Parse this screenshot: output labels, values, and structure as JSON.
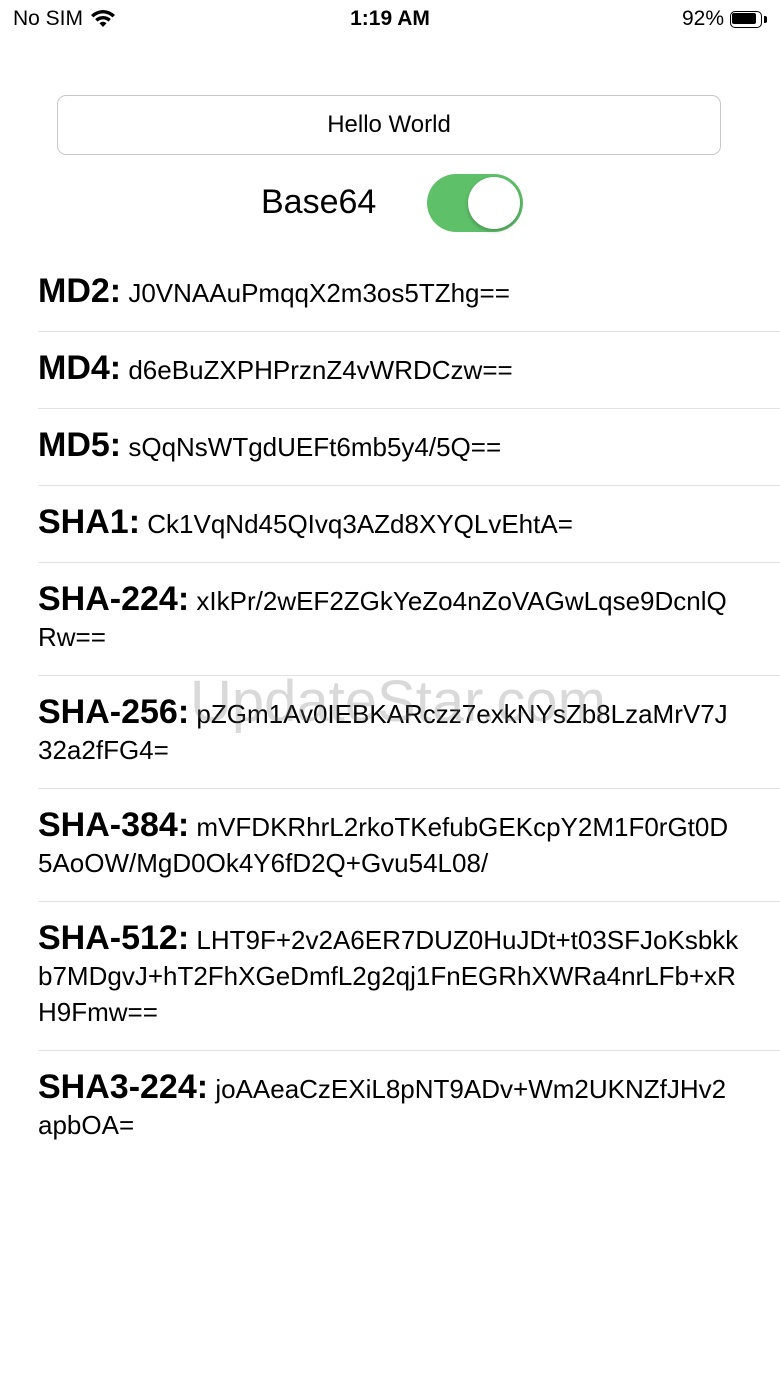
{
  "status_bar": {
    "carrier": "No SIM",
    "time": "1:19 AM",
    "battery_percent": "92%",
    "battery_level": 0.92,
    "icons": [
      "wifi-icon",
      "battery-icon"
    ]
  },
  "input": {
    "value": "Hello World"
  },
  "base64_toggle": {
    "label": "Base64",
    "on": true,
    "on_color": "#5ec16a"
  },
  "hashes": [
    {
      "name": "MD2:",
      "value": "J0VNAAuPmqqX2m3os5TZhg=="
    },
    {
      "name": "MD4:",
      "value": "d6eBuZXPHPrznZ4vWRDCzw=="
    },
    {
      "name": "MD5:",
      "value": "sQqNsWTgdUEFt6mb5y4/5Q=="
    },
    {
      "name": "SHA1:",
      "value": "Ck1VqNd45QIvq3AZd8XYQLvEhtA="
    },
    {
      "name": "SHA-224:",
      "value": "xIkPr/2wEF2ZGkYeZo4nZoVAGwLqse9DcnlQRw=="
    },
    {
      "name": "SHA-256:",
      "value": "pZGm1Av0IEBKARczz7exkNYsZb8LzaMrV7J32a2fFG4="
    },
    {
      "name": "SHA-384:",
      "value": "mVFDKRhrL2rkoTKefubGEKcpY2M1F0rGt0D5AoOW/MgD0Ok4Y6fD2Q+Gvu54L08/"
    },
    {
      "name": "SHA-512:",
      "value": "LHT9F+2v2A6ER7DUZ0HuJDt+t03SFJoKsbkkb7MDgvJ+hT2FhXGeDmfL2g2qj1FnEGRhXWRa4nrLFb+xRH9Fmw=="
    },
    {
      "name": "SHA3-224:",
      "value": "joAAeaCzEXiL8pNT9ADv+Wm2UKNZfJHv2apbOA="
    }
  ],
  "watermark": "UpdateStar.com"
}
